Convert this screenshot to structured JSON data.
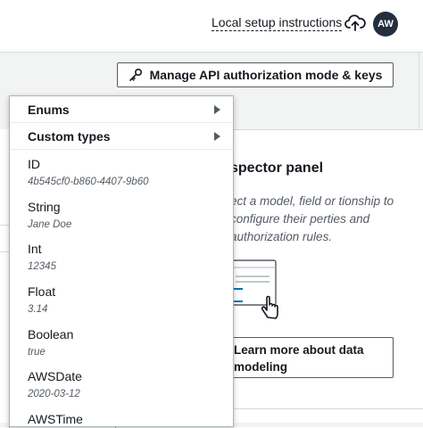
{
  "header": {
    "local_setup_link": "Local setup instructions",
    "avatar_initials": "AW",
    "icons": [
      "cloud-upload-icon"
    ]
  },
  "toolbar": {
    "manage_button_label": "Manage API authorization mode & keys",
    "manage_button_icon": "key-icon"
  },
  "inspector": {
    "title": "spector panel",
    "description": "ect a model, field or tionship to configure their perties and authorization rules.",
    "learn_more_label": "Learn more about data modeling",
    "illustration_icon": "pointer-hand-icon"
  },
  "dropdown": {
    "submenus": [
      {
        "label": "Enums"
      },
      {
        "label": "Custom types"
      }
    ],
    "types": [
      {
        "name": "ID",
        "example": "4b545cf0-b860-4407-9b60"
      },
      {
        "name": "String",
        "example": "Jane Doe"
      },
      {
        "name": "Int",
        "example": "12345"
      },
      {
        "name": "Float",
        "example": "3.14"
      },
      {
        "name": "Boolean",
        "example": "true"
      },
      {
        "name": "AWSDate",
        "example": "2020-03-12"
      },
      {
        "name": "AWSTime",
        "example": ""
      }
    ]
  },
  "colors": {
    "text": "#16191f",
    "secondary_text": "#545b64",
    "accent_blue": "#0073bb",
    "subbar_bg": "#f2f3f3",
    "avatar_bg": "#232f3e"
  }
}
